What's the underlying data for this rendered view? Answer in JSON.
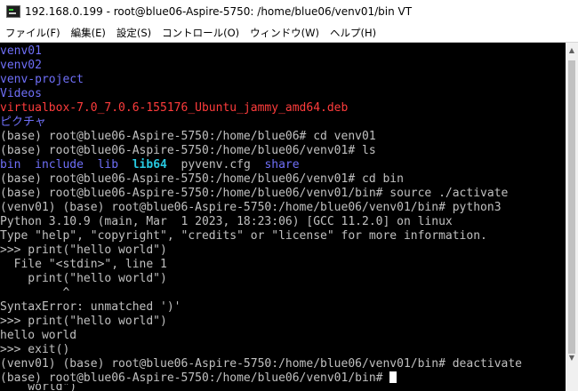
{
  "window": {
    "title": "192.168.0.199 - root@blue06-Aspire-5750: /home/blue06/venv01/bin VT"
  },
  "menu": {
    "items": [
      "ファイル(F)",
      "編集(E)",
      "設定(S)",
      "コントロール(O)",
      "ウィンドウ(W)",
      "ヘルプ(H)"
    ]
  },
  "terminal": {
    "lines": [
      {
        "segments": [
          {
            "text": "venv01",
            "color": "blue"
          }
        ]
      },
      {
        "segments": [
          {
            "text": "venv02",
            "color": "blue"
          }
        ]
      },
      {
        "segments": [
          {
            "text": "venv-project",
            "color": "blue"
          }
        ]
      },
      {
        "segments": [
          {
            "text": "Videos",
            "color": "blue"
          }
        ]
      },
      {
        "segments": [
          {
            "text": "virtualbox-7.0_7.0.6-155176_Ubuntu_jammy_amd64.deb",
            "color": "red"
          }
        ]
      },
      {
        "segments": [
          {
            "text": "ピクチャ",
            "color": "blue"
          }
        ]
      },
      {
        "segments": [
          {
            "text": "(base) root@blue06-Aspire-5750:/home/blue06# cd venv01"
          }
        ]
      },
      {
        "segments": [
          {
            "text": "(base) root@blue06-Aspire-5750:/home/blue06/venv01# ls"
          }
        ]
      },
      {
        "segments": [
          {
            "text": "bin",
            "color": "blue"
          },
          {
            "text": "  "
          },
          {
            "text": "include",
            "color": "blue"
          },
          {
            "text": "  "
          },
          {
            "text": "lib",
            "color": "blue"
          },
          {
            "text": "  "
          },
          {
            "text": "lib64",
            "color": "cyan"
          },
          {
            "text": "  pyvenv.cfg  "
          },
          {
            "text": "share",
            "color": "blue"
          }
        ]
      },
      {
        "segments": [
          {
            "text": "(base) root@blue06-Aspire-5750:/home/blue06/venv01# cd bin"
          }
        ]
      },
      {
        "segments": [
          {
            "text": "(base) root@blue06-Aspire-5750:/home/blue06/venv01/bin# source ./activate"
          }
        ]
      },
      {
        "segments": [
          {
            "text": "(venv01) (base) root@blue06-Aspire-5750:/home/blue06/venv01/bin# python3"
          }
        ]
      },
      {
        "segments": [
          {
            "text": "Python 3.10.9 (main, Mar  1 2023, 18:23:06) [GCC 11.2.0] on linux"
          }
        ]
      },
      {
        "segments": [
          {
            "text": "Type \"help\", \"copyright\", \"credits\" or \"license\" for more information."
          }
        ]
      },
      {
        "segments": [
          {
            "text": ">>> print(\"hello world\")"
          }
        ]
      },
      {
        "segments": [
          {
            "text": "  File \"<stdin>\", line 1"
          }
        ]
      },
      {
        "segments": [
          {
            "text": "    print(\"hello world\")"
          }
        ]
      },
      {
        "segments": [
          {
            "text": "         ^"
          }
        ]
      },
      {
        "segments": [
          {
            "text": "SyntaxError: unmatched ')'"
          }
        ]
      },
      {
        "segments": [
          {
            "text": ">>> print(\"hello world\")"
          }
        ]
      },
      {
        "segments": [
          {
            "text": "hello world"
          }
        ]
      },
      {
        "segments": [
          {
            "text": ">>> exit()"
          }
        ]
      },
      {
        "segments": [
          {
            "text": "(venv01) (base) root@blue06-Aspire-5750:/home/blue06/venv01/bin# deactivate"
          }
        ]
      },
      {
        "segments": [
          {
            "text": "(base) root@blue06-Aspire-5750:/home/blue06/venv01/bin# "
          }
        ],
        "cursor": true
      }
    ],
    "partial_line": "    world\")"
  },
  "colors": {
    "background": "#000000",
    "foreground": "#c0c0c0",
    "blue": "#6f6ff8",
    "red": "#ff3c3c",
    "cyan": "#27c9e0"
  },
  "scrollbar": {
    "up_icon": "scroll-up-arrow",
    "down_icon": "scroll-down-arrow"
  }
}
